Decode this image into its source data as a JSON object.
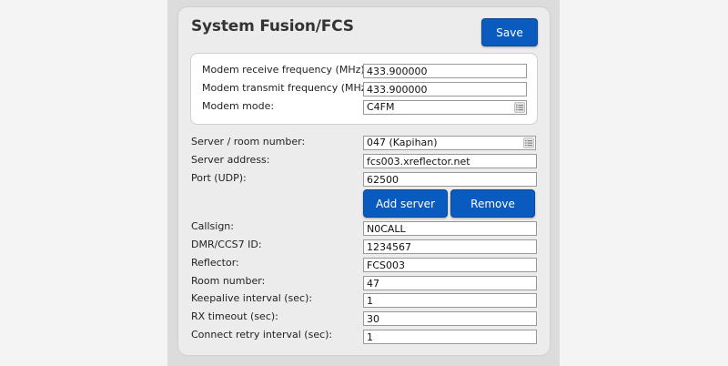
{
  "panel": {
    "title": "System Fusion/FCS",
    "save_label": "Save"
  },
  "modem": {
    "receive_label": "Modem receive frequency (MHz):",
    "receive_value": "433.900000",
    "transmit_label": "Modem transmit frequency (MHz):",
    "transmit_value": "433.900000",
    "mode_label": "Modem mode:",
    "mode_value": "C4FM"
  },
  "server": {
    "room_label": "Server / room number:",
    "room_value": "047 (Kapihan)",
    "address_label": "Server address:",
    "address_value": "fcs003.xreflector.net",
    "port_label": "Port (UDP):",
    "port_value": "62500",
    "add_label": "Add server",
    "remove_label": "Remove"
  },
  "settings": {
    "callsign_label": "Callsign:",
    "callsign_value": "N0CALL",
    "dmr_label": "DMR/CCS7 ID:",
    "dmr_value": "1234567",
    "reflector_label": "Reflector:",
    "reflector_value": "FCS003",
    "roomnum_label": "Room number:",
    "roomnum_value": "47",
    "keepalive_label": "Keepalive interval (sec):",
    "keepalive_value": "1",
    "rxtimeout_label": "RX timeout (sec):",
    "rxtimeout_value": "30",
    "retry_label": "Connect retry interval (sec):",
    "retry_value": "1"
  },
  "colors": {
    "button_bg": "#0a5bbf",
    "panel_bg": "#ececec"
  },
  "icons": {
    "select_toggle": "list-icon"
  }
}
